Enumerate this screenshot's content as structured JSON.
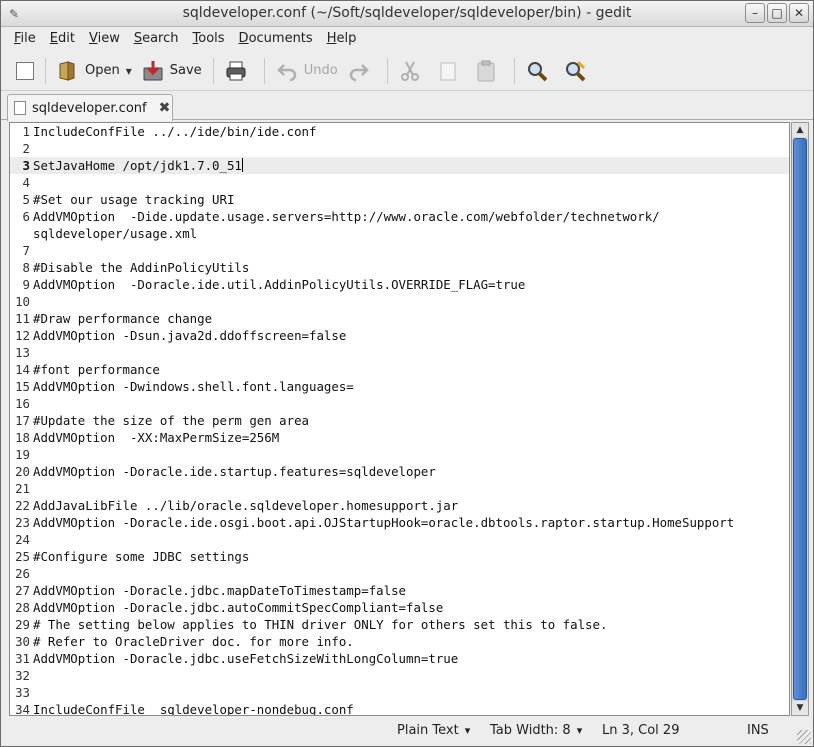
{
  "window": {
    "title": "sqldeveloper.conf (~/Soft/sqldeveloper/sqldeveloper/bin) - gedit",
    "controls": [
      "–",
      "□",
      "✕"
    ]
  },
  "menubar": {
    "items": [
      {
        "key": "F",
        "rest": "ile"
      },
      {
        "key": "E",
        "rest": "dit"
      },
      {
        "key": "V",
        "rest": "iew"
      },
      {
        "key": "S",
        "rest": "earch"
      },
      {
        "key": "T",
        "rest": "ools"
      },
      {
        "key": "D",
        "rest": "ocuments"
      },
      {
        "key": "H",
        "rest": "elp"
      }
    ]
  },
  "toolbar": {
    "open_label": "Open",
    "save_label": "Save",
    "undo_label": "Undo",
    "icons": [
      "new-document-icon",
      "open-folder-icon",
      "save-icon",
      "print-icon",
      "undo-icon",
      "redo-icon",
      "cut-icon",
      "copy-icon",
      "paste-icon",
      "find-icon",
      "find-replace-icon"
    ]
  },
  "tab": {
    "label": "sqldeveloper.conf",
    "close": "✖"
  },
  "editor": {
    "current_line": 3,
    "lines": [
      {
        "n": "1",
        "t": "IncludeConfFile ../../ide/bin/ide.conf"
      },
      {
        "n": "2",
        "t": ""
      },
      {
        "n": "3",
        "t": "SetJavaHome /opt/jdk1.7.0_51"
      },
      {
        "n": "4",
        "t": ""
      },
      {
        "n": "5",
        "t": "#Set our usage tracking URI"
      },
      {
        "n": "6",
        "t": "AddVMOption  -Dide.update.usage.servers=http://www.oracle.com/webfolder/technetwork/"
      },
      {
        "n": "",
        "t": "sqldeveloper/usage.xml"
      },
      {
        "n": "7",
        "t": ""
      },
      {
        "n": "8",
        "t": "#Disable the AddinPolicyUtils"
      },
      {
        "n": "9",
        "t": "AddVMOption  -Doracle.ide.util.AddinPolicyUtils.OVERRIDE_FLAG=true"
      },
      {
        "n": "10",
        "t": ""
      },
      {
        "n": "11",
        "t": "#Draw performance change"
      },
      {
        "n": "12",
        "t": "AddVMOption -Dsun.java2d.ddoffscreen=false"
      },
      {
        "n": "13",
        "t": ""
      },
      {
        "n": "14",
        "t": "#font performance"
      },
      {
        "n": "15",
        "t": "AddVMOption -Dwindows.shell.font.languages="
      },
      {
        "n": "16",
        "t": ""
      },
      {
        "n": "17",
        "t": "#Update the size of the perm gen area"
      },
      {
        "n": "18",
        "t": "AddVMOption  -XX:MaxPermSize=256M"
      },
      {
        "n": "19",
        "t": ""
      },
      {
        "n": "20",
        "t": "AddVMOption -Doracle.ide.startup.features=sqldeveloper"
      },
      {
        "n": "21",
        "t": ""
      },
      {
        "n": "22",
        "t": "AddJavaLibFile ../lib/oracle.sqldeveloper.homesupport.jar"
      },
      {
        "n": "23",
        "t": "AddVMOption -Doracle.ide.osgi.boot.api.OJStartupHook=oracle.dbtools.raptor.startup.HomeSupport"
      },
      {
        "n": "24",
        "t": ""
      },
      {
        "n": "25",
        "t": "#Configure some JDBC settings"
      },
      {
        "n": "26",
        "t": ""
      },
      {
        "n": "27",
        "t": "AddVMOption -Doracle.jdbc.mapDateToTimestamp=false"
      },
      {
        "n": "28",
        "t": "AddVMOption -Doracle.jdbc.autoCommitSpecCompliant=false"
      },
      {
        "n": "29",
        "t": "# The setting below applies to THIN driver ONLY for others set this to false."
      },
      {
        "n": "30",
        "t": "# Refer to OracleDriver doc. for more info."
      },
      {
        "n": "31",
        "t": "AddVMOption -Doracle.jdbc.useFetchSizeWithLongColumn=true"
      },
      {
        "n": "32",
        "t": ""
      },
      {
        "n": "33",
        "t": ""
      },
      {
        "n": "34",
        "t": "IncludeConfFile  sqldeveloper-nondebug.conf"
      }
    ]
  },
  "statusbar": {
    "language": "Plain Text",
    "tab_width": "Tab Width:  8",
    "position": "Ln 3, Col 29",
    "mode": "INS"
  }
}
